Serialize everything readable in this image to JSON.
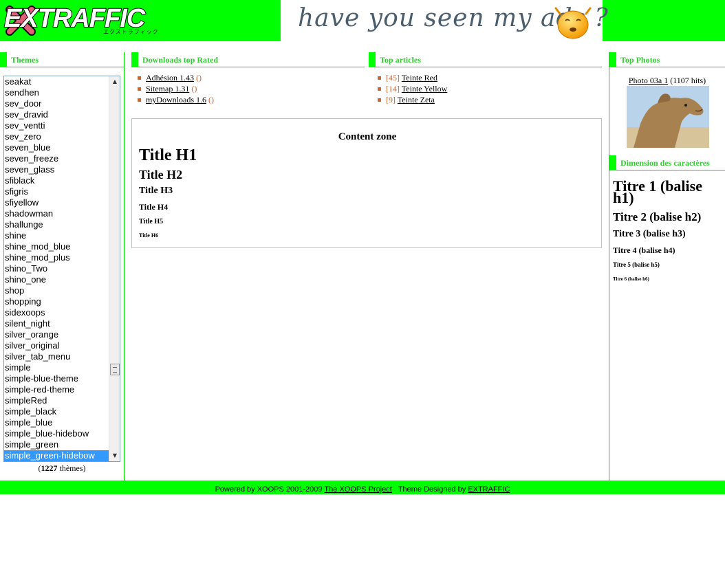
{
  "header": {
    "logo_text": "EXTRAFFIC",
    "logo_kana": "エクストラフィック",
    "banner_text": "have you seen my ads ?",
    "colors": {
      "header_bg": "#00ff00",
      "accent_orange": "#cc6633"
    }
  },
  "themes_block": {
    "title": "Themes",
    "options": [
      "seakat",
      "sendhen",
      "sev_door",
      "sev_dravid",
      "sev_ventti",
      "sev_zero",
      "seven_blue",
      "seven_freeze",
      "seven_glass",
      "sfiblack",
      "sfigris",
      "sfiyellow",
      "shadowman",
      "shallunge",
      "shine",
      "shine_mod_blue",
      "shine_mod_plus",
      "shino_Two",
      "shino_one",
      "shop",
      "shopping",
      "sidexoops",
      "silent_night",
      "silver_orange",
      "silver_original",
      "silver_tab_menu",
      "simple",
      "simple-blue-theme",
      "simple-red-theme",
      "simpleRed",
      "simple_black",
      "simple_blue",
      "simple_blue-hidebow",
      "simple_green",
      "simple_green-hidebow"
    ],
    "selected": "simple_green-hidebow",
    "count": "1227",
    "count_suffix": " thèmes)",
    "count_prefix": "("
  },
  "downloads_block": {
    "title": "Downloads top Rated",
    "items": [
      {
        "label": "Adhésion 1.43",
        "paren": "()"
      },
      {
        "label": "Sitemap 1.31",
        "paren": "()"
      },
      {
        "label": "myDownloads 1.6",
        "paren": "()"
      }
    ]
  },
  "articles_block": {
    "title": "Top articles",
    "items": [
      {
        "count": "[45]",
        "label": "Teinte Red"
      },
      {
        "count": "[14]",
        "label": "Teinte Yellow"
      },
      {
        "count": "[9]",
        "label": "Teinte Zeta"
      }
    ]
  },
  "content": {
    "zone_title": "Content zone",
    "h1": "Title H1",
    "h2": "Title H2",
    "h3": "Title H3",
    "h4": "Title H4",
    "h5": "Title H5",
    "h6": "Title H6"
  },
  "photos_block": {
    "title": "Top Photos",
    "photo_link": "Photo 03a 1",
    "photo_hits": " (1107 hits)"
  },
  "dimension_block": {
    "title": "Dimension des caractères",
    "t1": "Titre 1 (balise h1)",
    "t2": "Titre 2 (balise h2)",
    "t3": "Titre 3 (balise h3)",
    "t4": "Titre 4 (balise h4)",
    "t5": "Titre 5 (balise h5)",
    "t6": "Titre 6 (balise h6)"
  },
  "footer": {
    "powered": "Powered by XOOPS 2001-2009 ",
    "xoops_link": "The XOOPS Project",
    "designed": "   Theme Designed by ",
    "designer_link": "EXTRAFFIC"
  }
}
